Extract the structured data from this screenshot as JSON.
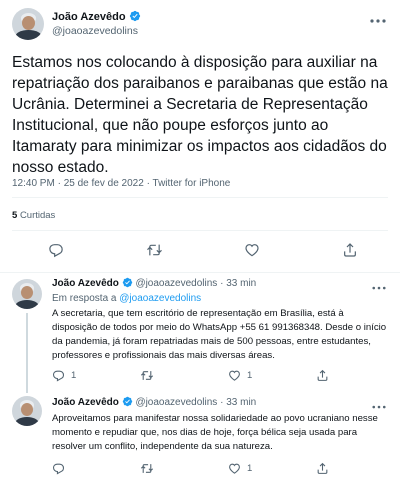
{
  "main_tweet": {
    "author_name": "João Azevêdo",
    "author_handle": "@joaoazevedolins",
    "more_icon": "more-horizontal-icon",
    "text": "Estamos nos colocando à disposição para auxiliar na repatriação dos paraibanos e paraibanas que estão na Ucrânia. Determinei a Secretaria de Representação Institucional, que não poupe esforços junto ao Itamaraty para minimizar os impactos aos cidadãos do nosso estado.",
    "time": "12:40 PM",
    "date": "25 de fev de 2022",
    "source": "Twitter for iPhone",
    "separator": "·",
    "likes_count": "5",
    "likes_label": "Curtidas",
    "colors": {
      "verified": "#1d9bf0",
      "link": "#1d9bf0"
    }
  },
  "replies": [
    {
      "author_name": "João Azevêdo",
      "author_handle": "@joaoazevedolins",
      "time_ago": "33 min",
      "separator": "·",
      "reply_to_label": "Em resposta a",
      "reply_to_handle": "@joaoazevedolins",
      "text": "A secretaria, que tem escritório de representação em Brasília, está à disposição de todos por meio do WhatsApp +55 61 991368348. Desde o início da pandemia, já foram repatriadas mais de 500 pessoas, entre estudantes, professores e profissionais das mais diversas áreas.",
      "reply_count": "1",
      "retweet_count": "",
      "like_count": "1"
    },
    {
      "author_name": "João Azevêdo",
      "author_handle": "@joaoazevedolins",
      "time_ago": "33 min",
      "separator": "·",
      "text": "Aproveitamos para manifestar nossa solidariedade ao povo ucraniano nesse momento e repudiar que, nos dias de hoje, força bélica seja usada para resolver um conflito, independente da sua natureza.",
      "reply_count": "",
      "retweet_count": "",
      "like_count": "1"
    }
  ]
}
